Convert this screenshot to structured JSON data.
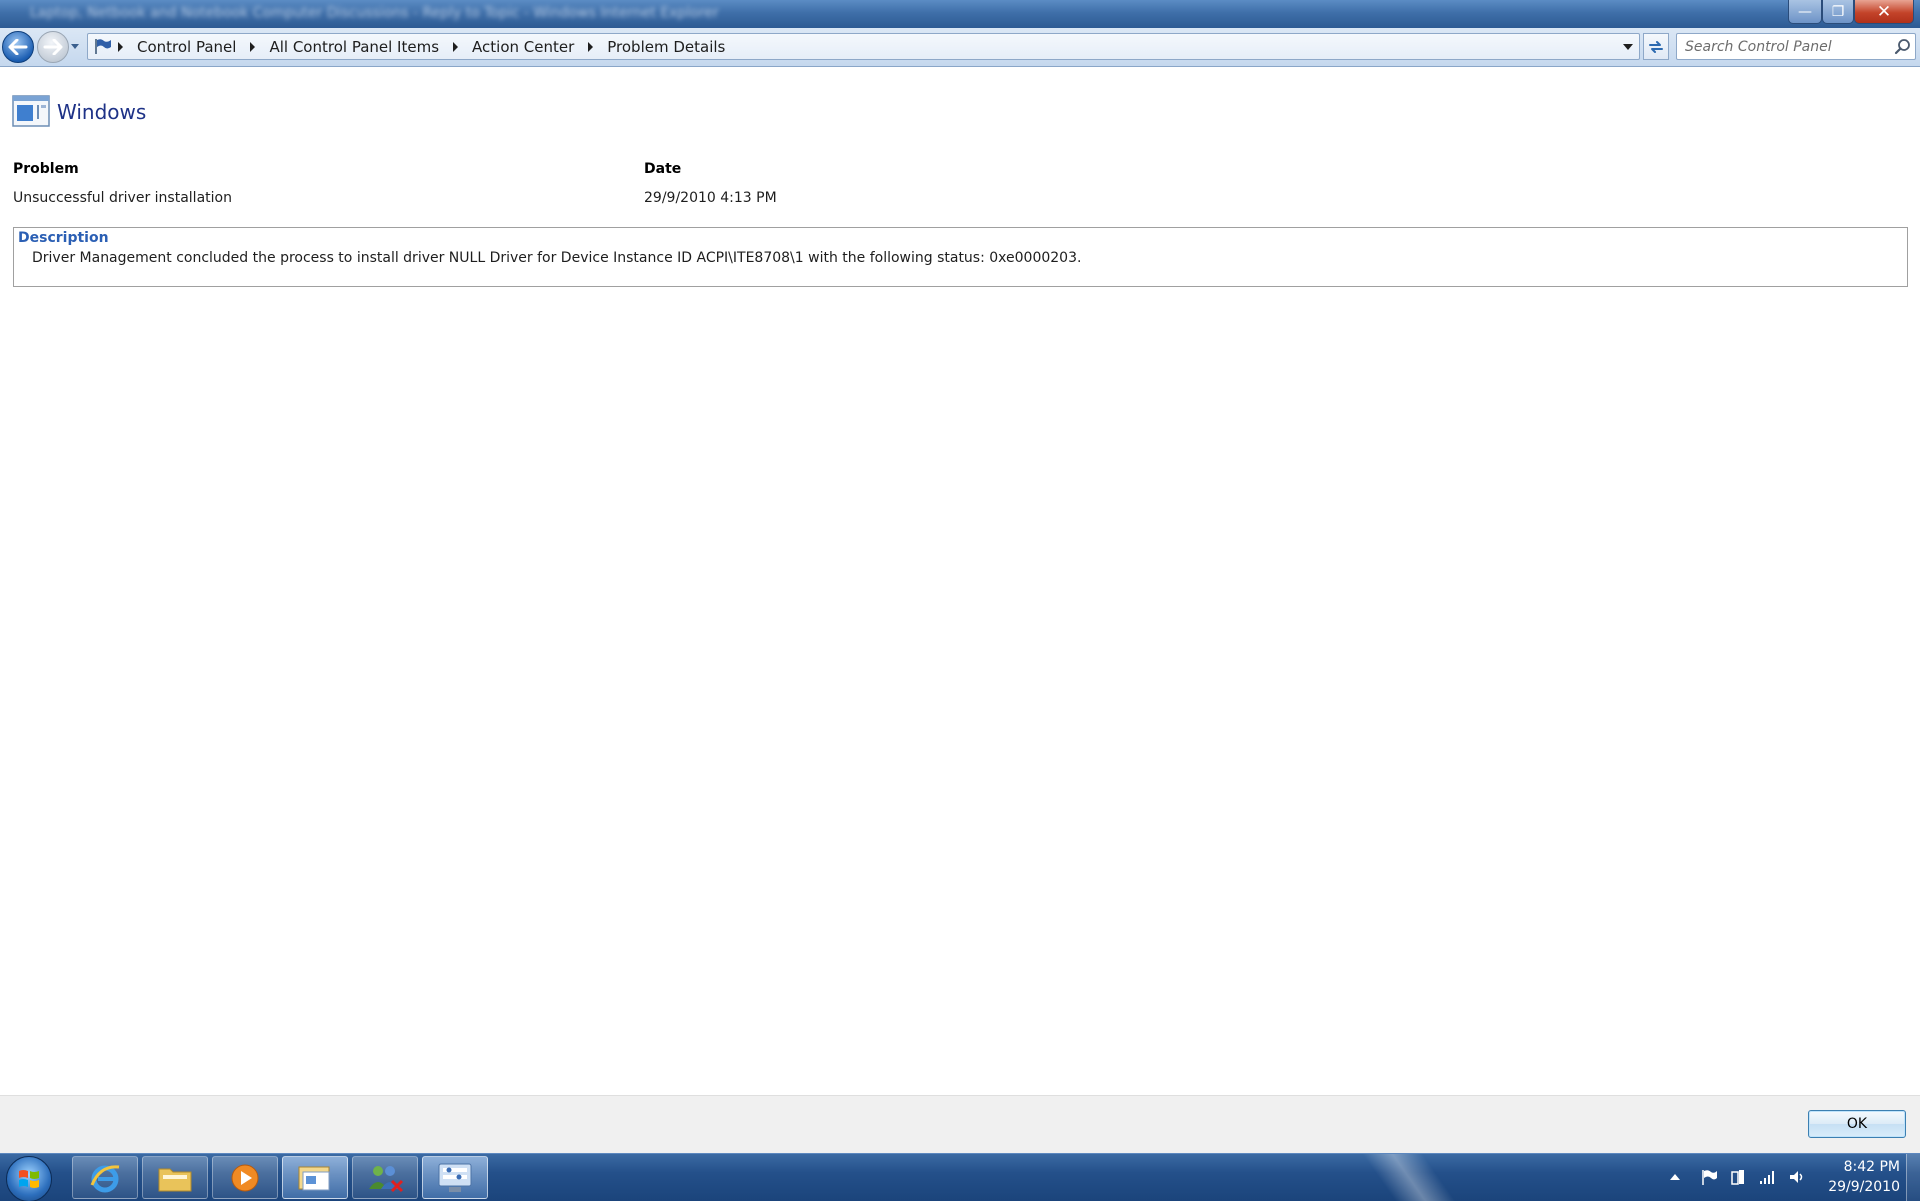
{
  "window": {
    "title": "Laptop, Netbook and Notebook Computer Discussions - Reply to Topic - Windows Internet Explorer",
    "minimize_label": "—",
    "maximize_label": "❐",
    "close_label": "✕"
  },
  "nav": {
    "breadcrumb": [
      "Control Panel",
      "All Control Panel Items",
      "Action Center",
      "Problem Details"
    ],
    "search_placeholder": "Search Control Panel"
  },
  "content": {
    "title": "Windows",
    "problem_header": "Problem",
    "date_header": "Date",
    "problem_value": "Unsuccessful driver installation",
    "date_value": "29/9/2010 4:13 PM",
    "description_label": "Description",
    "description_text": "Driver Management concluded the process to install driver NULL Driver for Device Instance ID ACPI\\ITE8708\\1 with the following status: 0xe0000203."
  },
  "footer": {
    "ok_label": "OK"
  },
  "taskbar": {
    "items": [
      {
        "name": "internet-explorer",
        "icon": "ie-icon"
      },
      {
        "name": "windows-explorer",
        "icon": "folder-icon"
      },
      {
        "name": "media-player",
        "icon": "media-player-icon"
      },
      {
        "name": "windows-explorer-window",
        "icon": "explorer-window-icon"
      },
      {
        "name": "network-users",
        "icon": "users-icon"
      },
      {
        "name": "control-panel",
        "icon": "control-panel-icon"
      }
    ],
    "clock_time": "8:42 PM",
    "clock_date": "29/9/2010"
  },
  "colors": {
    "title_blue": "#1e3287",
    "description_label_blue": "#2b5fb4",
    "taskbar_blue": "#24508a"
  }
}
